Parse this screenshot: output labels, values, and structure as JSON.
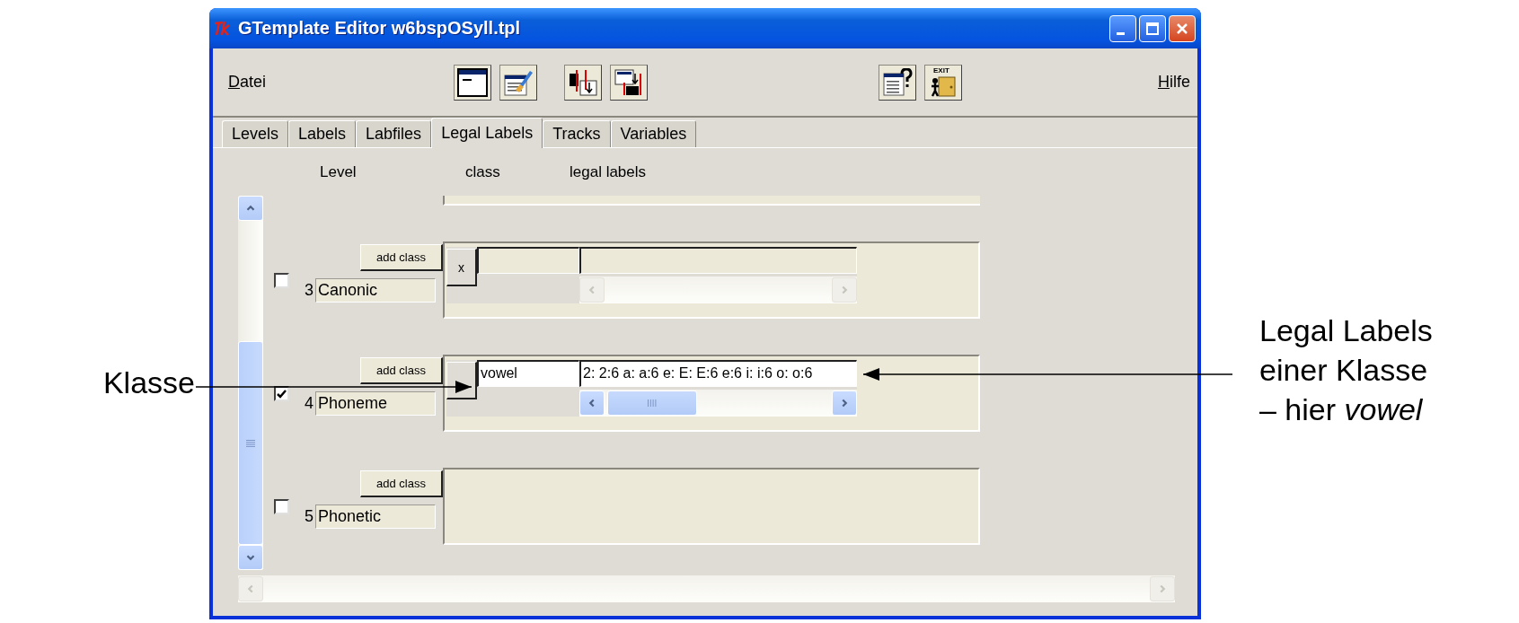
{
  "annotations": {
    "left": {
      "text": "Klasse"
    },
    "right": {
      "lines": [
        "Legal Labels",
        "einer Klasse",
        "– hier *vowel*"
      ]
    }
  },
  "window": {
    "title": "GTemplate Editor w6bspOSyll.tpl"
  },
  "menu": [
    "Datei",
    "Hilfe"
  ],
  "toolbar": [
    {
      "kind": "window"
    },
    {
      "kind": "brush"
    },
    {
      "kind": "split"
    },
    {
      "kind": "merge"
    },
    {
      "kind": "help"
    },
    {
      "kind": "exit",
      "label": "EXIT"
    }
  ],
  "tabs": [
    {
      "label": "Levels",
      "selected": false
    },
    {
      "label": "Labels",
      "selected": false
    },
    {
      "label": "Labfiles",
      "selected": false
    },
    {
      "label": "Legal Labels",
      "selected": true
    },
    {
      "label": "Tracks",
      "selected": false
    },
    {
      "label": "Variables",
      "selected": false
    }
  ],
  "columns": [
    "Level",
    "class",
    "legal labels"
  ],
  "levels": [
    {
      "number": "3",
      "name": "Canonic",
      "checked": false,
      "button": "add class",
      "classes": [
        {
          "delete": "x"
        }
      ]
    },
    {
      "number": "4",
      "name": "Phoneme",
      "checked": true,
      "button": "add class",
      "classes": [
        {
          "class": "vowel",
          "labels": "2: 2:6 a: a:6 e: E: E:6 e:6 i: i:6 o: o:6"
        }
      ]
    },
    {
      "number": "5",
      "name": "Phonetic",
      "checked": false,
      "button": "add class"
    }
  ]
}
